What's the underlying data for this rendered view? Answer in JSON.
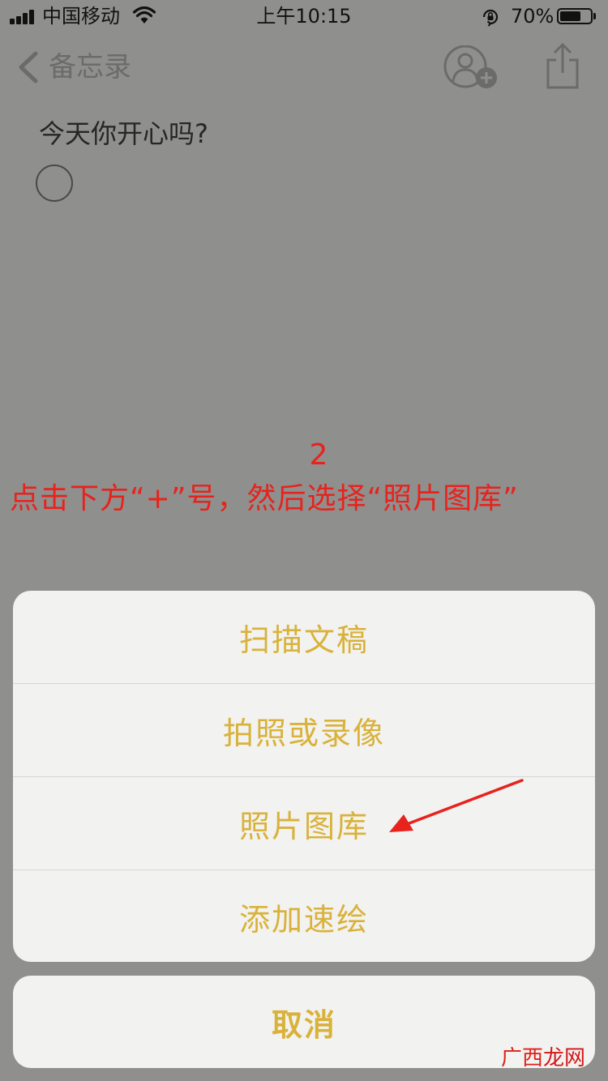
{
  "status_bar": {
    "carrier": "中国移动",
    "time": "上午10:15",
    "battery_percent": "70%",
    "battery_level": 0.7,
    "icons": [
      "signal-icon",
      "wifi-icon",
      "rotation-lock-icon",
      "battery-icon"
    ]
  },
  "nav": {
    "back_label": "备忘录",
    "icons": [
      "chevron-left-icon",
      "add-people-icon",
      "share-icon"
    ]
  },
  "note": {
    "text": "今天你开心吗?",
    "checklist_checked": false
  },
  "annotation": {
    "step": "2",
    "instruction": "点击下方“+”号，然后选择“照片图库”",
    "color": "#e8221c"
  },
  "action_sheet": {
    "items": [
      {
        "label": "扫描文稿"
      },
      {
        "label": "拍照或录像"
      },
      {
        "label": "照片图库"
      },
      {
        "label": "添加速绘"
      }
    ],
    "cancel_label": "取消",
    "accent_color": "#d9b23a"
  },
  "watermark": {
    "part1": "广西",
    "part2": "龙网"
  }
}
